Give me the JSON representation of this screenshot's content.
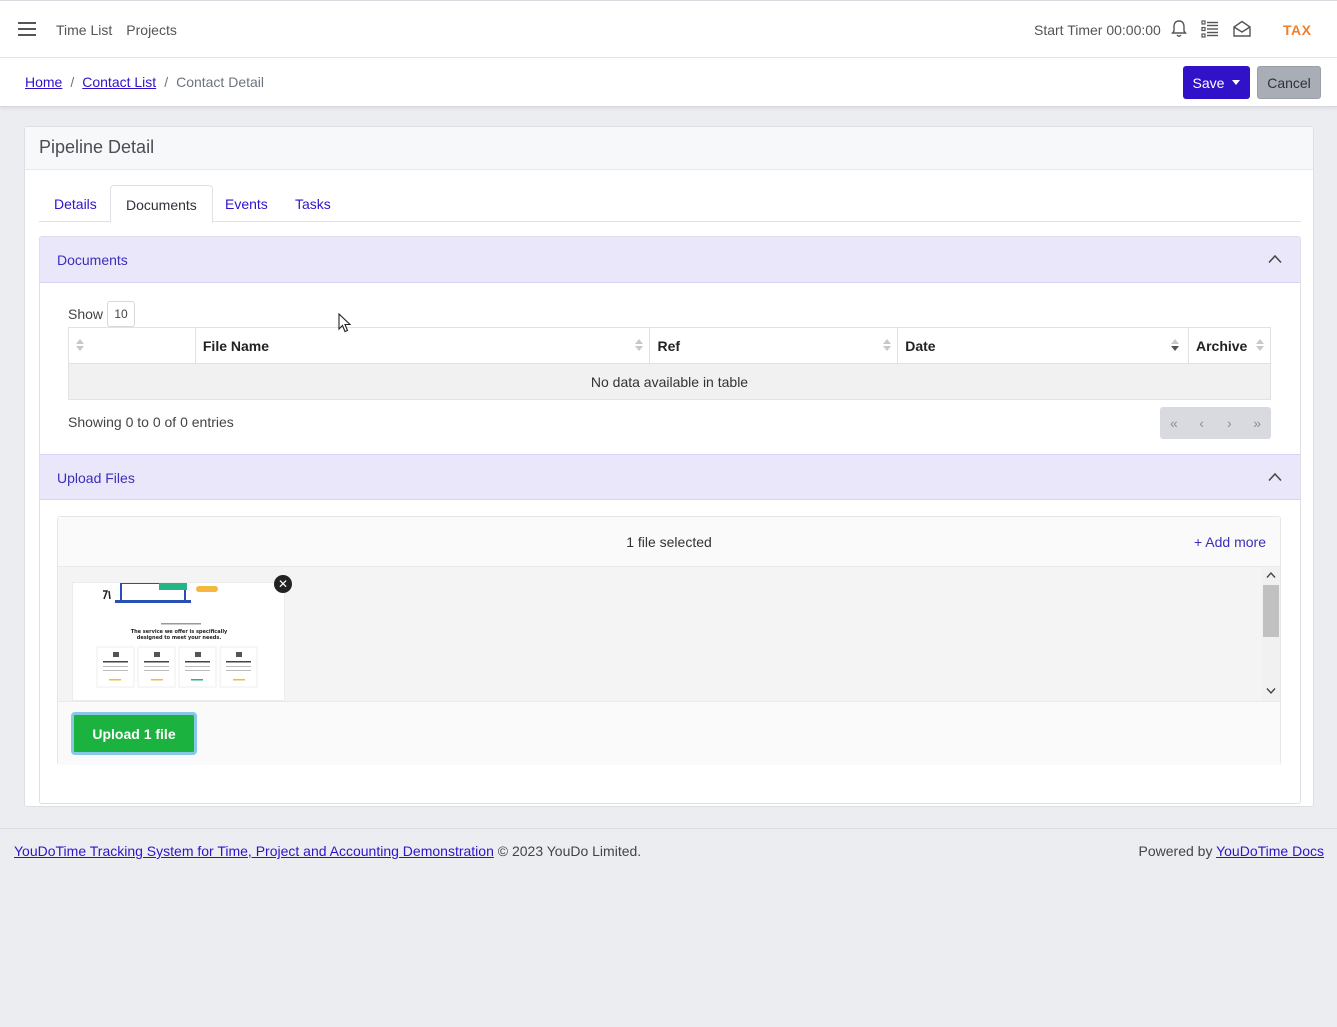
{
  "topbar": {
    "nav": [
      "Time List",
      "Projects"
    ],
    "timer_label": "Start Timer 00:00:00",
    "brand": "TAX",
    "icons": [
      "bell-icon",
      "list-icon",
      "envelope-icon"
    ]
  },
  "breadcrumb": {
    "home": "Home",
    "contact_list": "Contact List",
    "current": "Contact Detail",
    "sep": "/"
  },
  "actions": {
    "save": "Save",
    "cancel": "Cancel"
  },
  "card": {
    "title": "Pipeline Detail",
    "tabs": [
      "Details",
      "Documents",
      "Events",
      "Tasks"
    ],
    "active_tab": "Documents"
  },
  "documents": {
    "title": "Documents",
    "show_label": "Show",
    "show_value": "10",
    "columns": [
      "",
      "File Name",
      "Ref",
      "Date",
      "Archive"
    ],
    "empty_message": "No data available in table",
    "info": "Showing 0 to 0 of 0 entries",
    "pager": [
      "«",
      "‹",
      "›",
      "»"
    ]
  },
  "upload": {
    "title": "Upload Files",
    "count_label": "1 file selected",
    "add_more": "+ Add more",
    "upload_button": "Upload 1 file",
    "thumbnail_text": "The service we offer is specifically designed to meet your needs."
  },
  "footer": {
    "link": "YouDoTime Tracking System for Time, Project and Accounting Demonstration",
    "copyright": " © 2023 YouDo Limited.",
    "powered_by": "Powered by ",
    "docs_link": "YouDoTime Docs"
  },
  "colors": {
    "accent": "#3212c9",
    "section_header_bg": "#ebe7fb",
    "upload_button": "#1bb240",
    "brand": "#f07f2b"
  }
}
